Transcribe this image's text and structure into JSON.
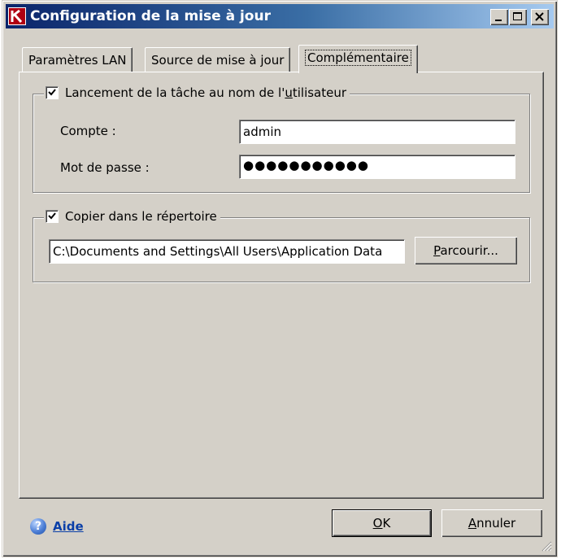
{
  "window": {
    "title": "Configuration de la mise à jour",
    "controls": {
      "minimize": "minimize-icon",
      "maximize": "maximize-icon",
      "close": "close-icon"
    }
  },
  "tabs": [
    {
      "label": "Paramètres LAN",
      "active": false
    },
    {
      "label": "Source de mise à jour",
      "active": false
    },
    {
      "label": "Complémentaire",
      "active": true
    }
  ],
  "user_task": {
    "checkbox_label_before": "Lancement de la tâche au nom de l'",
    "checkbox_label_accel": "u",
    "checkbox_label_after": "tilisateur",
    "checked": true,
    "account_label": "Compte :",
    "account_value": "admin",
    "password_label": "Mot de passe :",
    "password_value": "●●●●●●●●●●●"
  },
  "copy_dir": {
    "checkbox_label": "Copier dans le répertoire",
    "checked": true,
    "path_value": "C:\\Documents and Settings\\All Users\\Application Data",
    "browse_accel": "P",
    "browse_rest": "arcourir..."
  },
  "footer": {
    "help_icon": "help-icon",
    "help_label": "Aide",
    "ok_accel": "O",
    "ok_rest": "K",
    "cancel_accel": "A",
    "cancel_rest": "nnuler"
  },
  "colors": {
    "face": "#d4d0c8",
    "title_start": "#0a246a",
    "title_end": "#a6caf0",
    "link": "#0a3fa8"
  }
}
